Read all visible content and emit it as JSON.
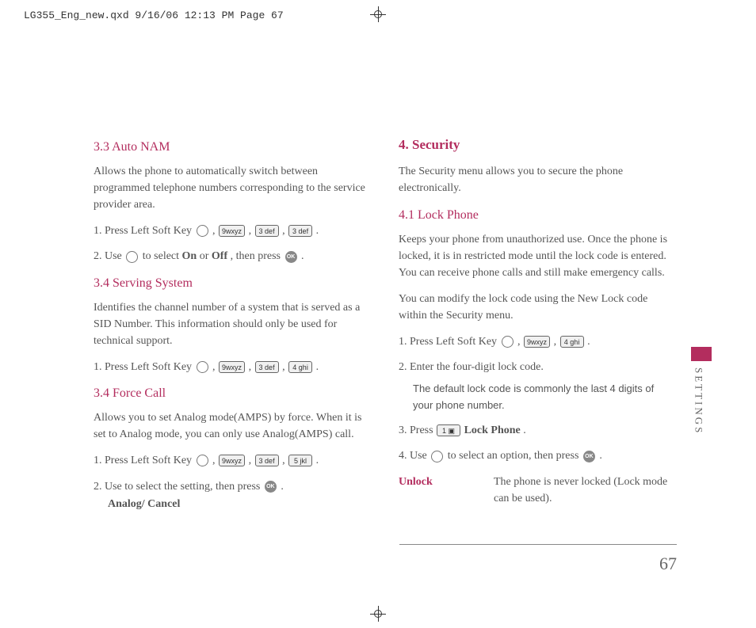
{
  "docHeader": "LG355_Eng_new.qxd  9/16/06  12:13 PM  Page 67",
  "sideLabel": "SETTINGS",
  "pageNumber": "67",
  "col1": {
    "s1_title": "3.3 Auto NAM",
    "s1_body": "Allows the phone to automatically switch between programmed telephone numbers corresponding to the service provider area.",
    "s1_step1_a": "1. Press Left Soft Key ",
    "s1_step1_b": " , ",
    "s1_step1_c": " , ",
    "s1_step1_d": " , ",
    "s1_step1_e": " .",
    "s1_step2_a": "2. Use ",
    "s1_step2_b": " to select ",
    "s1_step2_on": "On",
    "s1_step2_or": " or ",
    "s1_step2_off": "Off",
    "s1_step2_c": ", then press ",
    "s1_step2_d": " .",
    "s2_title": "3.4 Serving System",
    "s2_body": "Identifies the channel number of a system that is served as a SID Number. This information should only be used for technical support.",
    "s2_step1_a": "1. Press Left Soft Key ",
    "s3_title": "3.4 Force Call",
    "s3_body": "Allows you to set Analog mode(AMPS) by force. When it is set to Analog mode, you can only use Analog(AMPS) call.",
    "s3_step1_a": "1. Press Left Soft Key ",
    "s3_step2_a": "2. Use  to select the setting, then press ",
    "s3_step2_b": " .",
    "s3_step2_opts": "Analog/ Cancel"
  },
  "col2": {
    "h1": "4. Security",
    "h1_body": "The Security menu allows you to secure the phone electronically.",
    "s1_title": "4.1 Lock Phone",
    "s1_body1": "Keeps your phone from unauthorized use. Once the phone is locked, it is in restricted mode until the lock code is entered. You can receive phone calls and still make emergency calls.",
    "s1_body2": "You can modify the lock code using the New Lock code within the Security menu.",
    "step1_a": "1. Press Left Soft Key ",
    "step2": "2. Enter the four-digit lock code.",
    "step2_note": "The default lock code is commonly the last 4 digits of your phone number.",
    "step3_a": "3. Press ",
    "step3_b": "Lock Phone",
    "step3_c": ".",
    "step4_a": "4. Use ",
    "step4_b": " to select an option, then press ",
    "step4_c": " .",
    "unlock_label": "Unlock",
    "unlock_desc": "The phone is never locked (Lock mode can be used)."
  },
  "keys": {
    "nine": "9wxyz",
    "three": "3 def",
    "four": "4 ghi",
    "five": "5 jkl",
    "one": "1 ▣",
    "ok": "OK"
  }
}
